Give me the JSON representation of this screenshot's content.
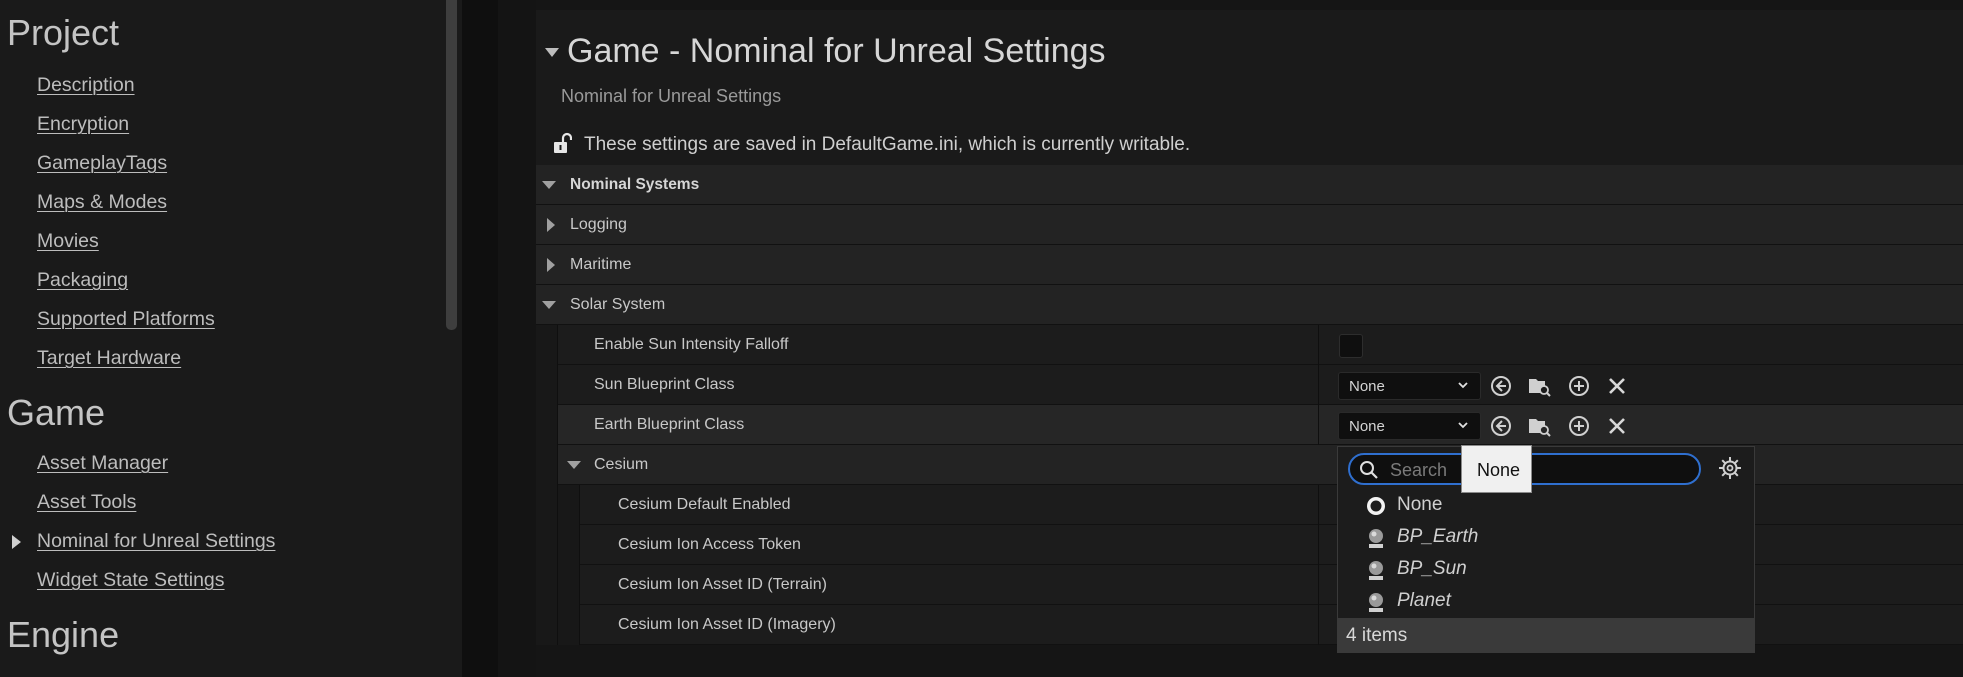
{
  "sidebar": {
    "sections": [
      {
        "title": "Project",
        "items": [
          "Description",
          "Encryption",
          "GameplayTags",
          "Maps & Modes",
          "Movies",
          "Packaging",
          "Supported Platforms",
          "Target Hardware"
        ]
      },
      {
        "title": "Game",
        "items": [
          "Asset Manager",
          "Asset Tools",
          "Nominal for Unreal Settings",
          "Widget State Settings"
        ]
      },
      {
        "title": "Engine",
        "items": []
      }
    ]
  },
  "header": {
    "title": "Game - Nominal for Unreal Settings",
    "subtitle": "Nominal for Unreal Settings",
    "writable_text": "These settings are saved in DefaultGame.ini, which is currently writable."
  },
  "grid": {
    "categories": {
      "nominal_systems": "Nominal Systems",
      "logging": "Logging",
      "maritime": "Maritime",
      "solar_system": "Solar System",
      "cesium": "Cesium"
    },
    "properties": {
      "enable_sun_falloff": "Enable Sun Intensity Falloff",
      "sun_blueprint": "Sun Blueprint Class",
      "earth_blueprint": "Earth Blueprint Class",
      "cesium_default": "Cesium Default Enabled",
      "cesium_token": "Cesium Ion Access Token",
      "cesium_terrain": "Cesium Ion Asset ID (Terrain)",
      "cesium_imagery": "Cesium Ion Asset ID (Imagery)"
    },
    "sun_blueprint_value": "None",
    "earth_blueprint_value": "None"
  },
  "picker": {
    "search_placeholder": "Search",
    "options": [
      "None",
      "BP_Earth",
      "BP_Sun",
      "Planet"
    ],
    "footer": "4 items",
    "tooltip": "None"
  },
  "colors": {
    "accent": "#2f6fcf",
    "background": "#151515",
    "panel": "#1a1a1a"
  }
}
